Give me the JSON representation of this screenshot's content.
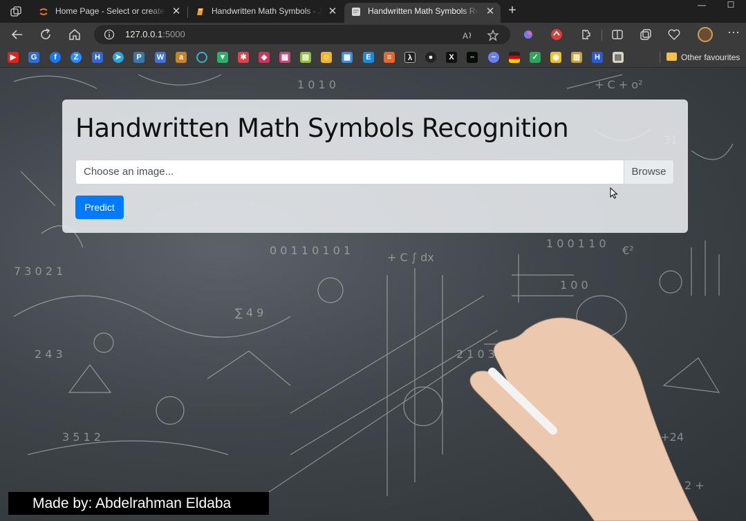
{
  "browser": {
    "tabs": [
      {
        "title": "Home Page - Select or create a n",
        "active": false
      },
      {
        "title": "Handwritten Math Symbols - Jup",
        "active": false
      },
      {
        "title": "Handwritten Math Symbols Reco",
        "active": true
      }
    ],
    "url_host": "127.0.0.1",
    "url_port": ":5000",
    "other_favourites": "Other favourites"
  },
  "page": {
    "title": "Handwritten Math Symbols Recognition",
    "file_placeholder": "Choose an image...",
    "browse_label": "Browse",
    "predict_label": "Predict",
    "footer": "Made by: Abdelrahman Eldaba"
  },
  "colors": {
    "primary": "#007bff",
    "card": "#e9ecef",
    "chrome": "#3b3b3b"
  }
}
